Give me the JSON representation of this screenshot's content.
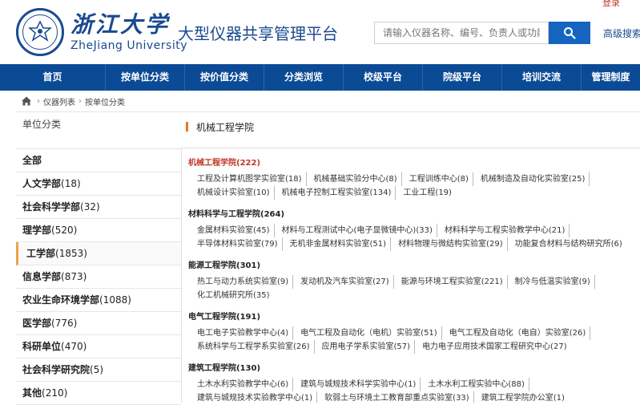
{
  "header": {
    "logo_cn": "浙江大学",
    "logo_en": "ZheJiang University",
    "platform_title": "大型仪器共享管理平台",
    "search_placeholder": "请输入仪器名称、编号、负责人或功能",
    "advanced_search": "高级搜索",
    "login": "登录"
  },
  "nav": {
    "items": [
      {
        "label": "首页"
      },
      {
        "label": "按单位分类"
      },
      {
        "label": "按价值分类"
      },
      {
        "label": "分类浏览"
      },
      {
        "label": "校级平台"
      },
      {
        "label": "院级平台"
      },
      {
        "label": "培训交流"
      },
      {
        "label": "管理制度"
      }
    ]
  },
  "breadcrumb": {
    "items": [
      "仪器列表",
      "按单位分类"
    ]
  },
  "sidebar": {
    "title": "单位分类",
    "items": [
      {
        "name": "全部",
        "count": ""
      },
      {
        "name": "人文学部",
        "count": "(18)"
      },
      {
        "name": "社会科学学部",
        "count": "(32)"
      },
      {
        "name": "理学部",
        "count": "(520)"
      },
      {
        "name": "工学部",
        "count": "(1853)"
      },
      {
        "name": "信息学部",
        "count": "(873)"
      },
      {
        "name": "农业生命环境学部",
        "count": "(1088)"
      },
      {
        "name": "医学部",
        "count": "(776)"
      },
      {
        "name": "科研单位",
        "count": "(470)"
      },
      {
        "name": "社会科学研究院",
        "count": "(5)"
      },
      {
        "name": "其他",
        "count": "(210)"
      }
    ]
  },
  "content": {
    "title": "机械工程学院",
    "colleges": [
      {
        "name": "机械工程学院(222)",
        "labs": [
          "工程及计算机图学实验室(18)",
          "机械基础实验分中心(8)",
          "工程训练中心(8)",
          "机械制造及自动化实验室(25)",
          "机械设计实验室(10)",
          "机械电子控制工程实验室(134)",
          "工业工程(19)"
        ]
      },
      {
        "name": "材料科学与工程学院(264)",
        "labs": [
          "金属材料实验室(45)",
          "材料与工程测试中心(电子显微镜中心)(33)",
          "材料科学与工程实验教学中心(21)",
          "半导体材料实验室(79)",
          "无机非金属材料实验室(51)",
          "材料物理与微结构实验室(29)",
          "功能复合材料与结构研究所(6)"
        ]
      },
      {
        "name": "能源工程学院(301)",
        "labs": [
          "热工与动力系统实验室(9)",
          "发动机及汽车实验室(27)",
          "能源与环境工程实验室(221)",
          "制冷与低温实验室(9)",
          "化工机械研究所(35)"
        ]
      },
      {
        "name": "电气工程学院(191)",
        "labs": [
          "电工电子实验教学中心(4)",
          "电气工程及自动化（电机）实验室(51)",
          "电气工程及自动化（电自）实验室(26)",
          "系统科学与工程学系实验室(26)",
          "应用电子学系实验室(57)",
          "电力电子应用技术国家工程研究中心(27)"
        ]
      },
      {
        "name": "建筑工程学院(130)",
        "labs": [
          "土木水利实验教学中心(6)",
          "建筑与城规技术科学实验中心(1)",
          "土木水利工程实验中心(88)",
          "建筑与城规技术实验教学中心(1)",
          "软弱土与环境土工教育部重点实验室(33)",
          "建筑工程学院办公室(1)"
        ]
      }
    ]
  },
  "colors": {
    "nav_bg": "#0b4a95",
    "brand": "#1a4a8f",
    "search_btn": "#1565c0",
    "highlight": "#c0392b",
    "active_marker": "#f0a14a"
  },
  "icons": [
    "university-seal-icon",
    "search-icon",
    "home-icon"
  ]
}
